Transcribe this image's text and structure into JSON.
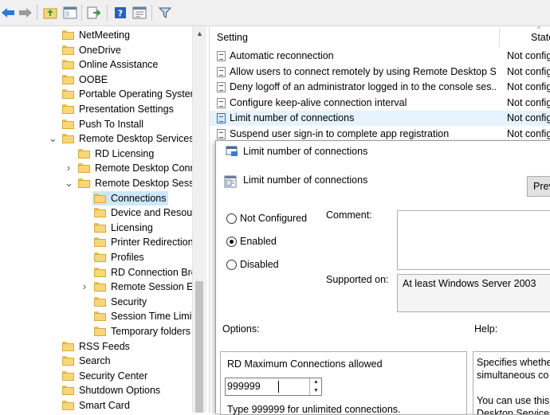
{
  "toolbar": {
    "icons": [
      "back-arrow-icon",
      "forward-arrow-icon",
      "up-folder-icon",
      "show-hide-tree-icon",
      "export-list-icon",
      "help-icon",
      "properties-icon",
      "filter-icon"
    ]
  },
  "tree": {
    "items": [
      {
        "label": "NetMeeting"
      },
      {
        "label": "OneDrive"
      },
      {
        "label": "Online Assistance"
      },
      {
        "label": "OOBE"
      },
      {
        "label": "Portable Operating System"
      },
      {
        "label": "Presentation Settings"
      },
      {
        "label": "Push To Install"
      },
      {
        "label": "Remote Desktop Services"
      },
      {
        "label": "RD Licensing"
      },
      {
        "label": "Remote Desktop Conn"
      },
      {
        "label": "Remote Desktop Sessio"
      },
      {
        "label": "Connections"
      },
      {
        "label": "Device and Resour"
      },
      {
        "label": "Licensing"
      },
      {
        "label": "Printer Redirection"
      },
      {
        "label": "Profiles"
      },
      {
        "label": "RD Connection Bro"
      },
      {
        "label": "Remote Session En"
      },
      {
        "label": "Security"
      },
      {
        "label": "Session Time Limit"
      },
      {
        "label": "Temporary folders"
      },
      {
        "label": "RSS Feeds"
      },
      {
        "label": "Search"
      },
      {
        "label": "Security Center"
      },
      {
        "label": "Shutdown Options"
      },
      {
        "label": "Smart Card"
      }
    ]
  },
  "list": {
    "col_setting": "Setting",
    "col_state": "State",
    "rows": [
      {
        "setting": "Automatic reconnection",
        "state": "Not config"
      },
      {
        "setting": "Allow users to connect remotely by using Remote Desktop S...",
        "state": "Not config"
      },
      {
        "setting": "Deny logoff of an administrator logged in to the console ses...",
        "state": "Not config"
      },
      {
        "setting": "Configure keep-alive connection interval",
        "state": "Not config"
      },
      {
        "setting": "Limit number of connections",
        "state": "Not config"
      },
      {
        "setting": "Suspend user sign-in to complete app registration",
        "state": "Not config"
      }
    ]
  },
  "dialog": {
    "title": "Limit number of connections",
    "policy_name": "Limit number of connections",
    "prev_button": "Prev",
    "radio_not_configured": "Not Configured",
    "radio_enabled": "Enabled",
    "radio_disabled": "Disabled",
    "comment_label": "Comment:",
    "supported_on_label": "Supported on:",
    "supported_on_value": "At least Windows Server 2003",
    "options_label": "Options:",
    "help_label": "Help:",
    "max_connections_label": "RD Maximum Connections allowed",
    "max_connections_value": "999999",
    "unlimited_hint": "Type 999999 for unlimited connections.",
    "help_line1": "Specifies whether",
    "help_line2": "simultaneous co",
    "help_line3": "You can use this s",
    "help_line4": "Desktop Services"
  }
}
